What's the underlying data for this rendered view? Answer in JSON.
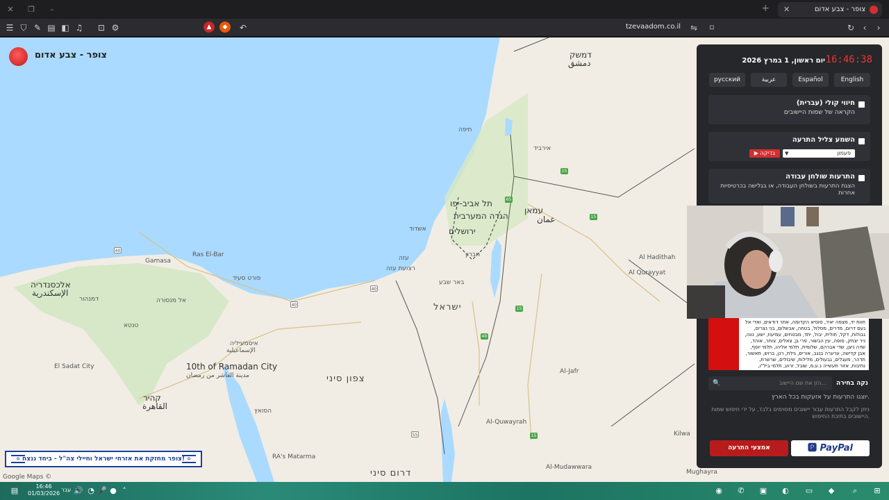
{
  "browser": {
    "tab_title": "צופר - צבע אדום",
    "url": "tzevaadom.co.il",
    "icons": [
      "menu-icon",
      "shield-icon",
      "brush-icon",
      "tabs-icon",
      "sidebar-icon",
      "music-icon",
      "screenshot-icon",
      "extension-icon"
    ]
  },
  "site": {
    "title": "צופר - צבע אדום",
    "banner": "צופר מחזקת את אזרחי ישראל וחיילי צה\"ל - ביחד ננצח!",
    "attribution": "Google Maps ©"
  },
  "map_labels": {
    "israel": "ישראל",
    "tel_aviv": "תל אביב-יפו",
    "jerusalem": "ירושלים",
    "west_bank": "הגדה המערבית",
    "amman_he": "עמאן",
    "amman_ar": "عمان",
    "damascus_he": "דמשק",
    "damascus_ar": "دمشق",
    "ashdod": "אשדוד",
    "gaza": "עזה",
    "gaza_strip": "רצועת עזה",
    "beersheba": "באר שבע",
    "hebron": "חברון",
    "sinai": "צפון סיני",
    "south_sinai": "דרום סיני",
    "cairo_he": "קהיר",
    "cairo_ar": "القاهرة",
    "alexandria_he": "אלכסנדריה",
    "alexandria_ar": "الإسكندرية",
    "ismailia_he": "איסמעיליה",
    "ismailia_ar": "الإسماعيلية",
    "suez": "הסואץ",
    "port_said": "פורט סעיד",
    "tenth_ramadan": "10th of Ramadan City",
    "tenth_ramadan_ar": "مدينة العاشر من رمضان",
    "haifa": "חיפה",
    "irbid": "אירביד",
    "al_jafr": "Al-Jafr",
    "al_quwayrah": "Al-Quwayrah",
    "al_haditha": "Al Hadithah",
    "al_qurayyat": "Al Qurayyat",
    "mansoura": "אל מנסורה",
    "tanta": "טנטא",
    "el_sadat": "El Sadat City",
    "gamasa": "Gamasa",
    "ras_el_bar": "Ras El-Bar",
    "damanhur": "דמנהור",
    "kilwa": "Kilwa",
    "al_mudawwara": "Al-Mudawwara",
    "mughayra": "Mughayra",
    "ras_matarma": "RA's Matarma"
  },
  "panel": {
    "clock": "16:46:38",
    "date": "יום ראשון, 1 במרץ 2026",
    "languages": [
      "English",
      "Español",
      "عربية",
      "русский"
    ],
    "voice": {
      "title": "חיווי קולי (עברית)",
      "subtitle": "הקראה של שמות היישובים"
    },
    "sound": {
      "title": "השמע צליל התרעה",
      "select_value": "פעמון",
      "test_label": "בדיקה"
    },
    "desktop": {
      "title": "התרעות שולחן עבודה",
      "subtitle": "הצגת התרעות בשולחן העבודה, או בגלישה בכרטיסיות אחרות"
    },
    "cities_text": "חוות יזי, מצפה יאיר, סוסיא הקדומה, אתר דודאים, ואדי אל נעם דרום, מדרים, מסלול, בטחה, אבשלום, בני נצרים, גבולות, דקל, חולית, יבול, יתד, מבטחים, עמיעוז, ישע, נווה, ניר יצחק, סופה, עין הבשור, פרי גן, צאלים, צוחר, אוהד, שדה ניצן, שדי אברהם, שלומית, תלמי אליהו, תלמי יוסף, אבן קדישה, ערערה בנגב, אורים, גילת, רנן, ברוש, תאשור, תדהר, מעגלים, גבעולים, מלילות, שיבולים, שרשרת, נתיבות, אזור תעשייה נ.ע.מ, שובל, זרוע, תלמי ביל\"ו, פטיש, קלחים",
    "search_placeholder": "הזן את שם היישוב...",
    "clear_label": "נקה בחירה",
    "note1": "יוצגו התרעות על אזעקות בכל הארץ.",
    "note2": "ניתן לקבל התרעות עבור יישובים מסוימים בלבד, על ידי חיפוש שמות היישובים בתיבת החיפוש.",
    "alert_means_label": "אמצעי התרעה",
    "paypal_label": "PayPal"
  },
  "taskbar": {
    "time": "16:46",
    "date": "01/03/2026",
    "lang": "עבר"
  },
  "colors": {
    "accent": "#d32f2f",
    "panel_bg": "#26272b",
    "sea": "#aadaff",
    "land": "#f1ede4"
  }
}
